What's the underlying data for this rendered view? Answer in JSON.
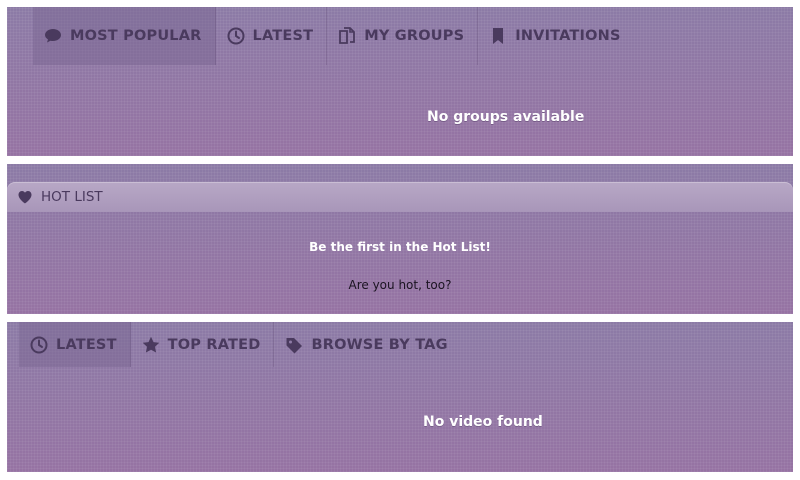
{
  "groups_panel": {
    "tabs": [
      {
        "label": "MOST POPULAR",
        "icon": "speech-bubble-icon",
        "active": true
      },
      {
        "label": "LATEST",
        "icon": "clock-icon",
        "active": false
      },
      {
        "label": "MY GROUPS",
        "icon": "documents-icon",
        "active": false
      },
      {
        "label": "INVITATIONS",
        "icon": "bookmark-icon",
        "active": false
      }
    ],
    "empty_message": "No groups available"
  },
  "hot_list_panel": {
    "title": "HOT LIST",
    "icon": "heart-icon",
    "headline": "Be the first in the Hot List!",
    "prompt": "Are you hot, too?"
  },
  "videos_panel": {
    "tabs": [
      {
        "label": "LATEST",
        "icon": "clock-icon",
        "active": true
      },
      {
        "label": "TOP RATED",
        "icon": "star-icon",
        "active": false
      },
      {
        "label": "BROWSE BY TAG",
        "icon": "tag-icon",
        "active": false
      }
    ],
    "empty_message": "No video found"
  },
  "colors": {
    "panel_bg": "#8e7ba6",
    "tab_text": "#4a3a5e",
    "message_text": "#ffffff"
  }
}
